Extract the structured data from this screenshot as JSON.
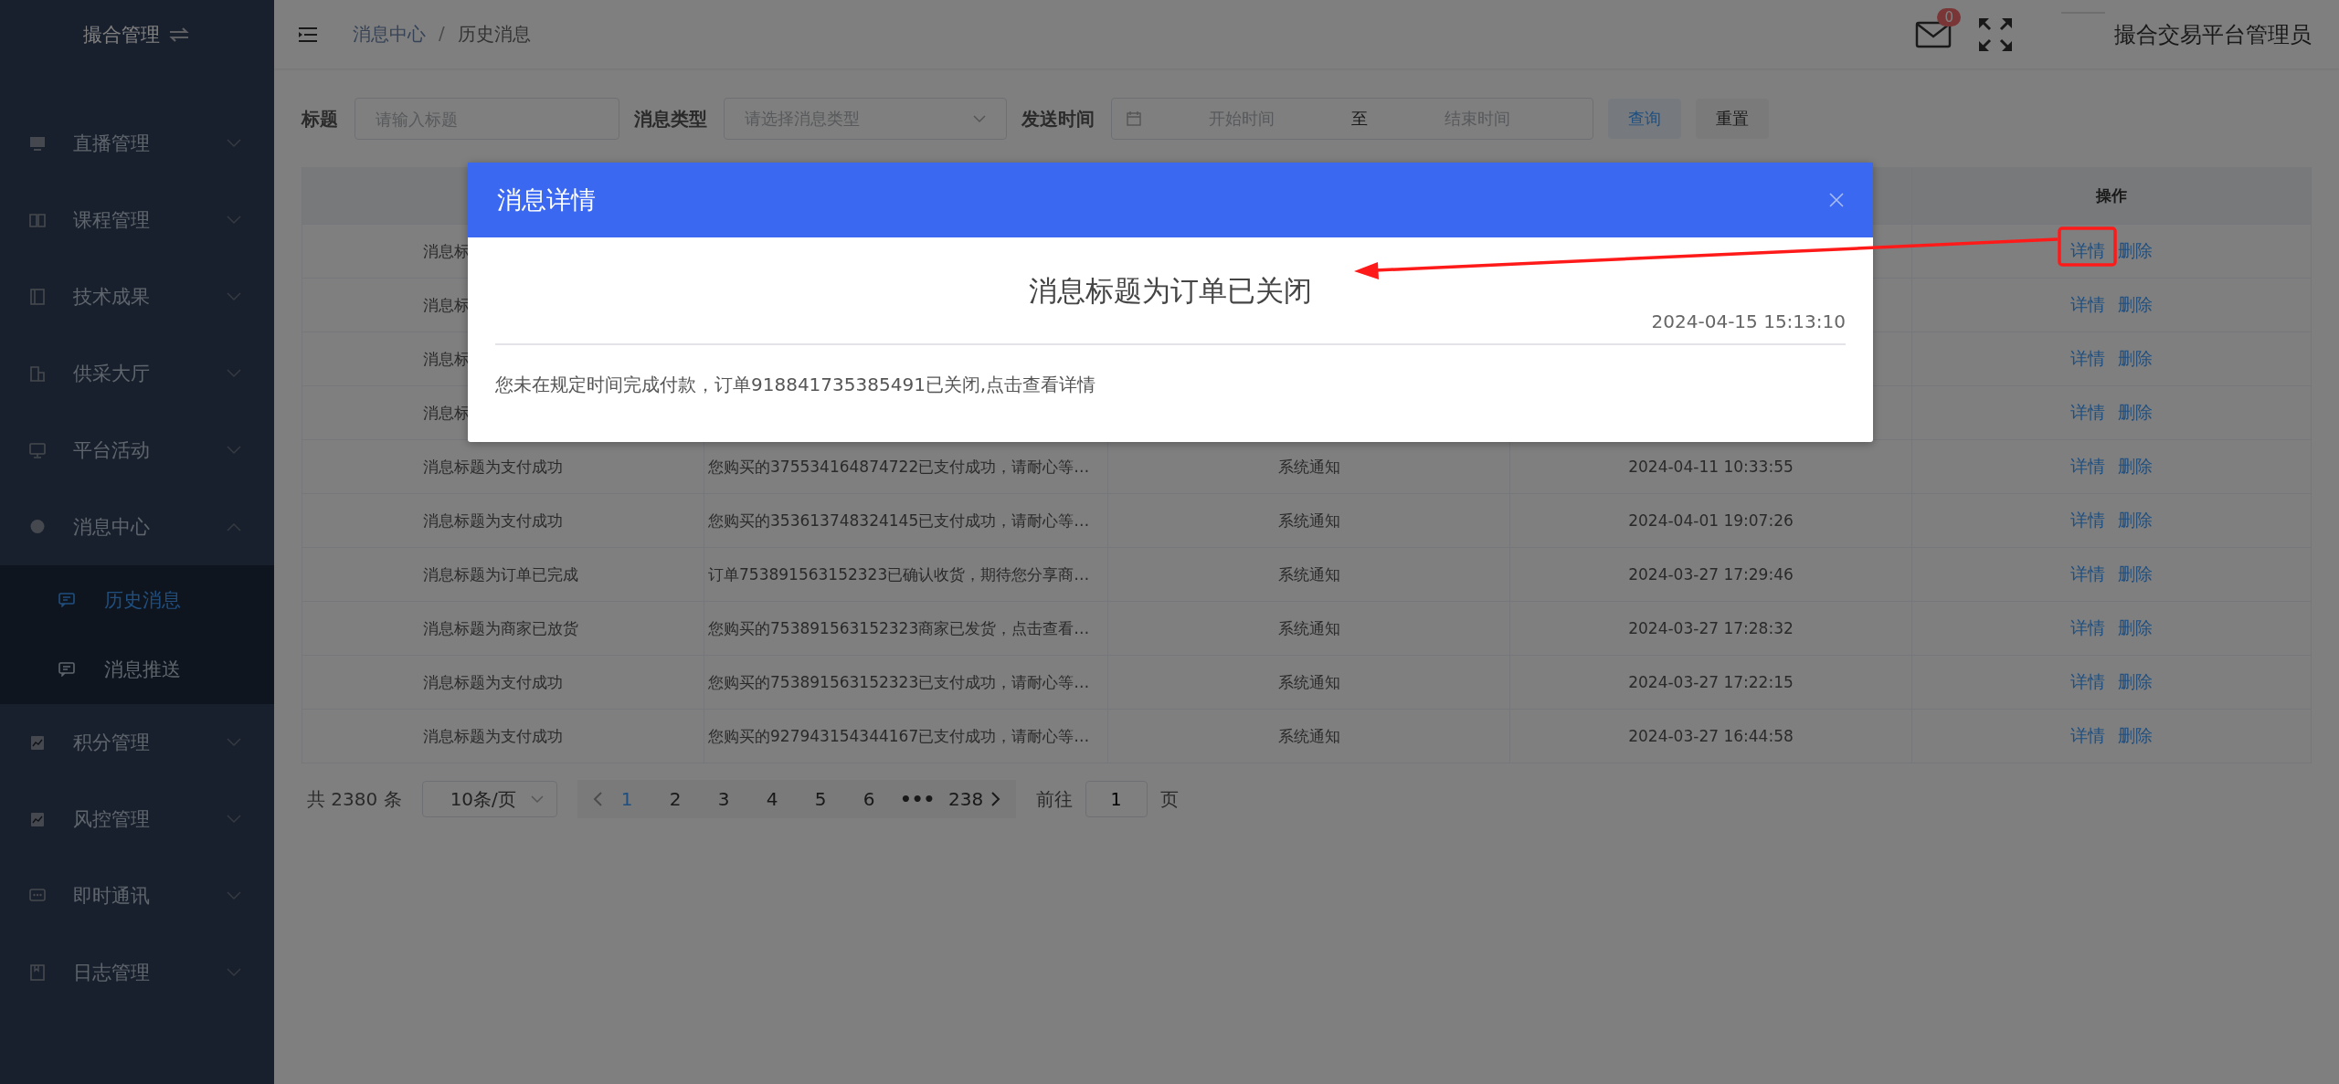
{
  "sidebar": {
    "title": "撮合管理",
    "items": [
      {
        "label": "直播管理",
        "expanded": false
      },
      {
        "label": "课程管理",
        "expanded": false
      },
      {
        "label": "技术成果",
        "expanded": false
      },
      {
        "label": "供采大厅",
        "expanded": false
      },
      {
        "label": "平台活动",
        "expanded": false
      },
      {
        "label": "消息中心",
        "expanded": true,
        "children": [
          {
            "label": "历史消息",
            "selected": true
          },
          {
            "label": "消息推送",
            "selected": false
          }
        ]
      },
      {
        "label": "积分管理",
        "expanded": false
      },
      {
        "label": "风控管理",
        "expanded": false
      },
      {
        "label": "即时通讯",
        "expanded": false
      },
      {
        "label": "日志管理",
        "expanded": false
      }
    ]
  },
  "header": {
    "breadcrumb": [
      "消息中心",
      "历史消息"
    ],
    "breadcrumb_separator": "/",
    "mail_badge": "0",
    "user_name": "撮合交易平台管理员"
  },
  "filters": [
    {
      "kind": "input",
      "label": "标题",
      "placeholder": "请输入标题"
    },
    {
      "kind": "select",
      "label": "消息类型",
      "placeholder": "请选择消息类型"
    },
    {
      "kind": "daterange",
      "label": "发送时间",
      "start_placeholder": "开始时间",
      "separator": "至",
      "end_placeholder": "结束时间"
    }
  ],
  "buttons": [
    {
      "kind": "primary",
      "label": "查询"
    },
    {
      "kind": "default",
      "label": "重置"
    }
  ],
  "table": {
    "actions_heading": "操作",
    "rows": [
      {
        "title": "消息标",
        "actions": [
          "详情",
          "删除"
        ]
      },
      {
        "title": "消息标",
        "actions": [
          "详情",
          "删除"
        ]
      },
      {
        "title": "消息标",
        "actions": [
          "详情",
          "删除"
        ]
      },
      {
        "title": "消息标",
        "actions": [
          "详情",
          "删除"
        ]
      },
      {
        "title": "消息标题为支付成功",
        "content": "您购买的375534164874722已支付成功，请耐心等…",
        "type": "系统通知",
        "time": "2024-04-11 10:33:55",
        "actions": [
          "详情",
          "删除"
        ]
      },
      {
        "title": "消息标题为支付成功",
        "content": "您购买的353613748324145已支付成功，请耐心等…",
        "type": "系统通知",
        "time": "2024-04-01 19:07:26",
        "actions": [
          "详情",
          "删除"
        ]
      },
      {
        "title": "消息标题为订单已完成",
        "content": "订单753891563152323已确认收货，期待您分享商…",
        "type": "系统通知",
        "time": "2024-03-27 17:29:46",
        "actions": [
          "详情",
          "删除"
        ]
      },
      {
        "title": "消息标题为商家已放货",
        "content": "您购买的753891563152323商家已发货，点击查看…",
        "type": "系统通知",
        "time": "2024-03-27 17:28:32",
        "actions": [
          "详情",
          "删除"
        ]
      },
      {
        "title": "消息标题为支付成功",
        "content": "您购买的753891563152323已支付成功，请耐心等…",
        "type": "系统通知",
        "time": "2024-03-27 17:22:15",
        "actions": [
          "详情",
          "删除"
        ]
      },
      {
        "title": "消息标题为支付成功",
        "content": "您购买的927943154344167已支付成功，请耐心等…",
        "type": "系统通知",
        "time": "2024-03-27 16:44:58",
        "actions": [
          "详情",
          "删除"
        ]
      }
    ]
  },
  "pagination": {
    "total": "共 2380 条",
    "page_size": "10条/页",
    "pages": [
      {
        "kind": "page",
        "label": "1",
        "selected": true
      },
      {
        "kind": "page",
        "label": "2",
        "selected": false
      },
      {
        "kind": "page",
        "label": "3",
        "selected": false
      },
      {
        "kind": "page",
        "label": "4",
        "selected": false
      },
      {
        "kind": "page",
        "label": "5",
        "selected": false
      },
      {
        "kind": "page",
        "label": "6",
        "selected": false
      },
      {
        "kind": "more",
        "label": "•••",
        "selected": false
      },
      {
        "kind": "page",
        "label": "238",
        "selected": false
      }
    ],
    "goto_label": "前往",
    "goto_value": "1",
    "page_suffix": "页"
  },
  "dialog": {
    "title": "消息详情",
    "heading": "消息标题为订单已关闭",
    "time": "2024-04-15 15:13:10",
    "body": "您未在规定时间完成付款，订单918841735385491已关闭,点击查看详情"
  }
}
